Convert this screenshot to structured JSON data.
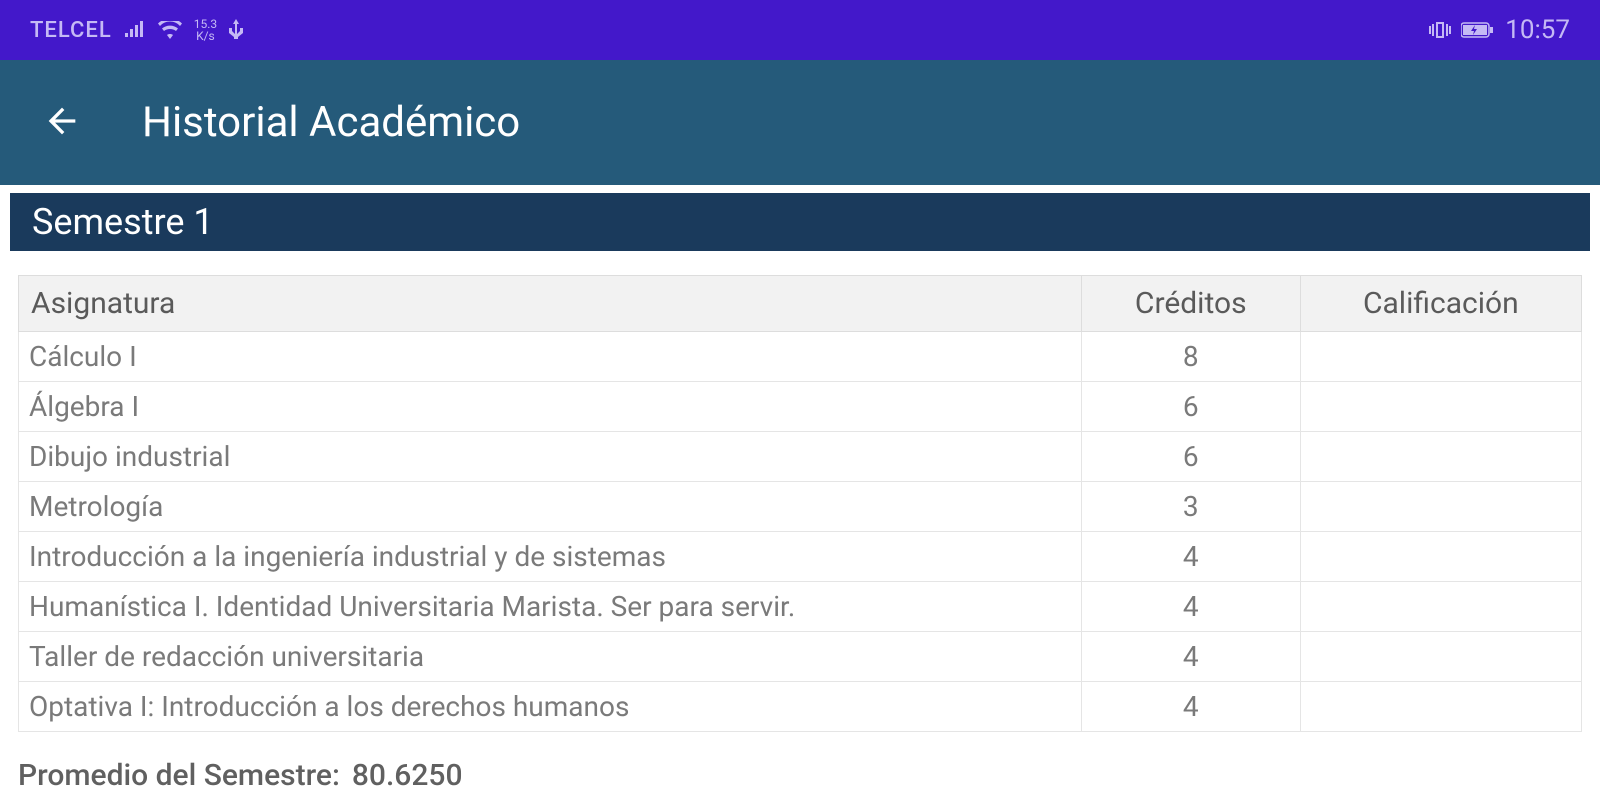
{
  "status_bar": {
    "carrier": "TELCEL",
    "speed_top": "15.3",
    "speed_bottom": "K/s",
    "clock": "10:57"
  },
  "app_bar": {
    "title": "Historial Académico"
  },
  "section": {
    "title": "Semestre 1"
  },
  "table": {
    "headers": {
      "subject": "Asignatura",
      "credits": "Créditos",
      "grade": "Calificación"
    },
    "rows": [
      {
        "subject": "Cálculo I",
        "credits": "8",
        "grade": ""
      },
      {
        "subject": "Álgebra I",
        "credits": "6",
        "grade": ""
      },
      {
        "subject": "Dibujo industrial",
        "credits": "6",
        "grade": ""
      },
      {
        "subject": "Metrología",
        "credits": "3",
        "grade": ""
      },
      {
        "subject": "Introducción a la ingeniería industrial y de sistemas",
        "credits": "4",
        "grade": ""
      },
      {
        "subject": "Humanística I. Identidad Universitaria Marista. Ser para servir.",
        "credits": "4",
        "grade": ""
      },
      {
        "subject": "Taller de redacción universitaria",
        "credits": "4",
        "grade": ""
      },
      {
        "subject": "Optativa I: Introducción a los derechos humanos",
        "credits": "4",
        "grade": ""
      }
    ]
  },
  "average": {
    "label": "Promedio del Semestre:",
    "value": "80.6250"
  }
}
